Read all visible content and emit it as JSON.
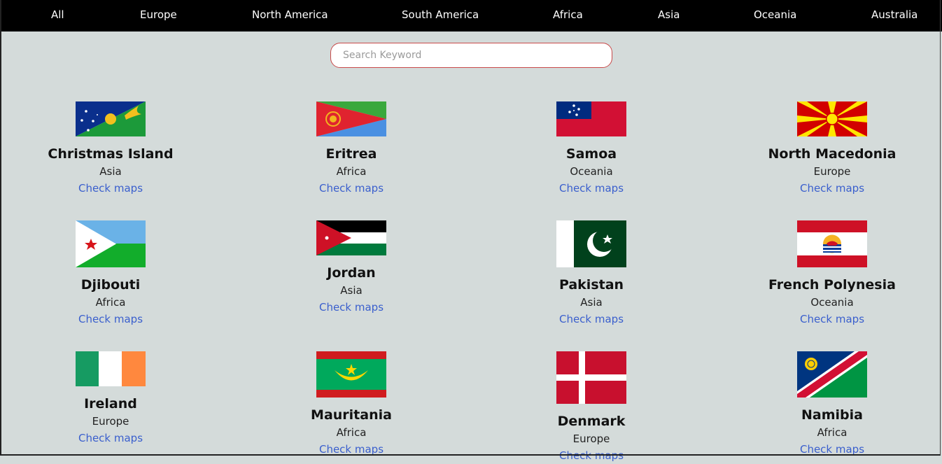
{
  "nav": {
    "items": [
      "All",
      "Europe",
      "North America",
      "South America",
      "Africa",
      "Asia",
      "Oceania",
      "Australia"
    ]
  },
  "search": {
    "placeholder": "Search Keyword",
    "value": ""
  },
  "countries": [
    {
      "name": "Christmas Island",
      "region": "Asia",
      "link": "Check maps"
    },
    {
      "name": "Eritrea",
      "region": "Africa",
      "link": "Check maps"
    },
    {
      "name": "Samoa",
      "region": "Oceania",
      "link": "Check maps"
    },
    {
      "name": "North Macedonia",
      "region": "Europe",
      "link": "Check maps"
    },
    {
      "name": "Djibouti",
      "region": "Africa",
      "link": "Check maps"
    },
    {
      "name": "Jordan",
      "region": "Asia",
      "link": "Check maps"
    },
    {
      "name": "Pakistan",
      "region": "Asia",
      "link": "Check maps"
    },
    {
      "name": "French Polynesia",
      "region": "Oceania",
      "link": "Check maps"
    },
    {
      "name": "Ireland",
      "region": "Europe",
      "link": "Check maps"
    },
    {
      "name": "Mauritania",
      "region": "Africa",
      "link": "Check maps"
    },
    {
      "name": "Denmark",
      "region": "Europe",
      "link": "Check maps"
    },
    {
      "name": "Namibia",
      "region": "Africa",
      "link": "Check maps"
    }
  ],
  "colors": {
    "nav_bg": "#000000",
    "page_bg": "#d4dbda",
    "link": "#3a5fcd",
    "search_border": "#c84a4a"
  }
}
